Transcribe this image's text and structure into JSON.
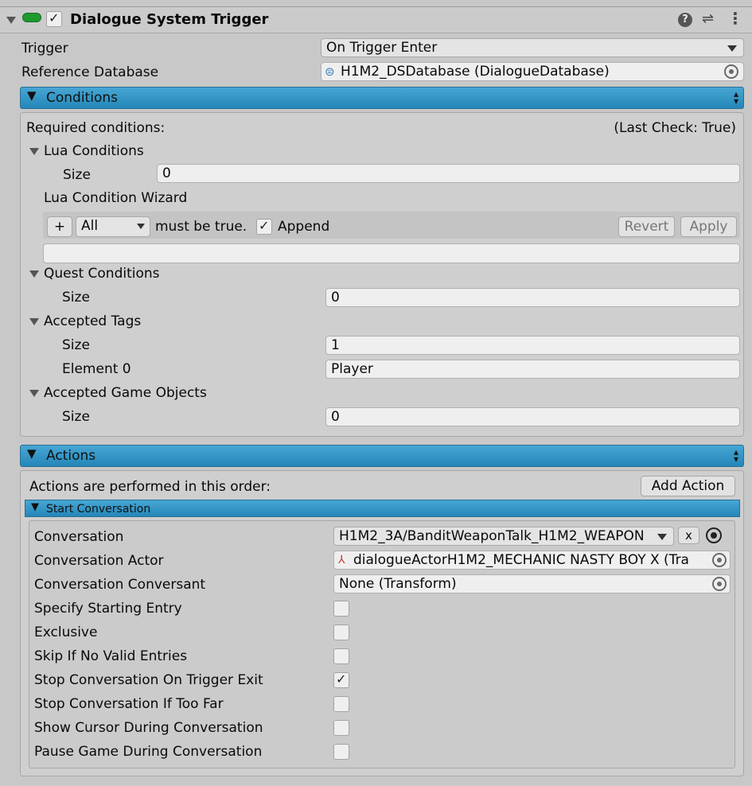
{
  "component": {
    "title": "Dialogue System Trigger",
    "enabled": true
  },
  "trigger": {
    "label": "Trigger",
    "value": "On Trigger Enter"
  },
  "reference_database": {
    "label": "Reference Database",
    "value": "H1M2_DSDatabase (DialogueDatabase)"
  },
  "conditions": {
    "header": "Conditions",
    "required_label": "Required conditions:",
    "last_check": "(Last Check: True)",
    "lua_conditions": {
      "label": "Lua Conditions",
      "size_label": "Size",
      "size_value": "0"
    },
    "lua_wizard": {
      "label": "Lua Condition Wizard",
      "plus": "+",
      "mode": "All",
      "must_be_true": "must be true.",
      "append_label": "Append",
      "append_checked": true,
      "revert": "Revert",
      "apply": "Apply"
    },
    "quest_conditions": {
      "label": "Quest Conditions",
      "size_label": "Size",
      "size_value": "0"
    },
    "accepted_tags": {
      "label": "Accepted Tags",
      "size_label": "Size",
      "size_value": "1",
      "element0_label": "Element 0",
      "element0_value": "Player"
    },
    "accepted_game_objects": {
      "label": "Accepted Game Objects",
      "size_label": "Size",
      "size_value": "0"
    }
  },
  "actions": {
    "header": "Actions",
    "order_text": "Actions are performed in this order:",
    "add_action": "Add Action",
    "start_conversation": {
      "header": "Start Conversation",
      "conversation_label": "Conversation",
      "conversation_value": "H1M2_3A/BanditWeaponTalk_H1M2_WEAPON",
      "clear": "x",
      "actor_label": "Conversation Actor",
      "actor_value": "dialogueActorH1M2_MECHANIC NASTY BOY X (Tra",
      "conversant_label": "Conversation Conversant",
      "conversant_value": "None (Transform)",
      "toggles": [
        {
          "label": "Specify Starting Entry",
          "checked": false
        },
        {
          "label": "Exclusive",
          "checked": false
        },
        {
          "label": "Skip If No Valid Entries",
          "checked": false
        },
        {
          "label": "Stop Conversation On Trigger Exit",
          "checked": true
        },
        {
          "label": "Stop Conversation If Too Far",
          "checked": false
        },
        {
          "label": "Show Cursor During Conversation",
          "checked": false
        },
        {
          "label": "Pause Game During Conversation",
          "checked": false
        }
      ]
    }
  },
  "colors": {
    "section_bar": "#2f93c4",
    "background": "#c8c8c8",
    "component_icon": "#1f9a2e"
  }
}
